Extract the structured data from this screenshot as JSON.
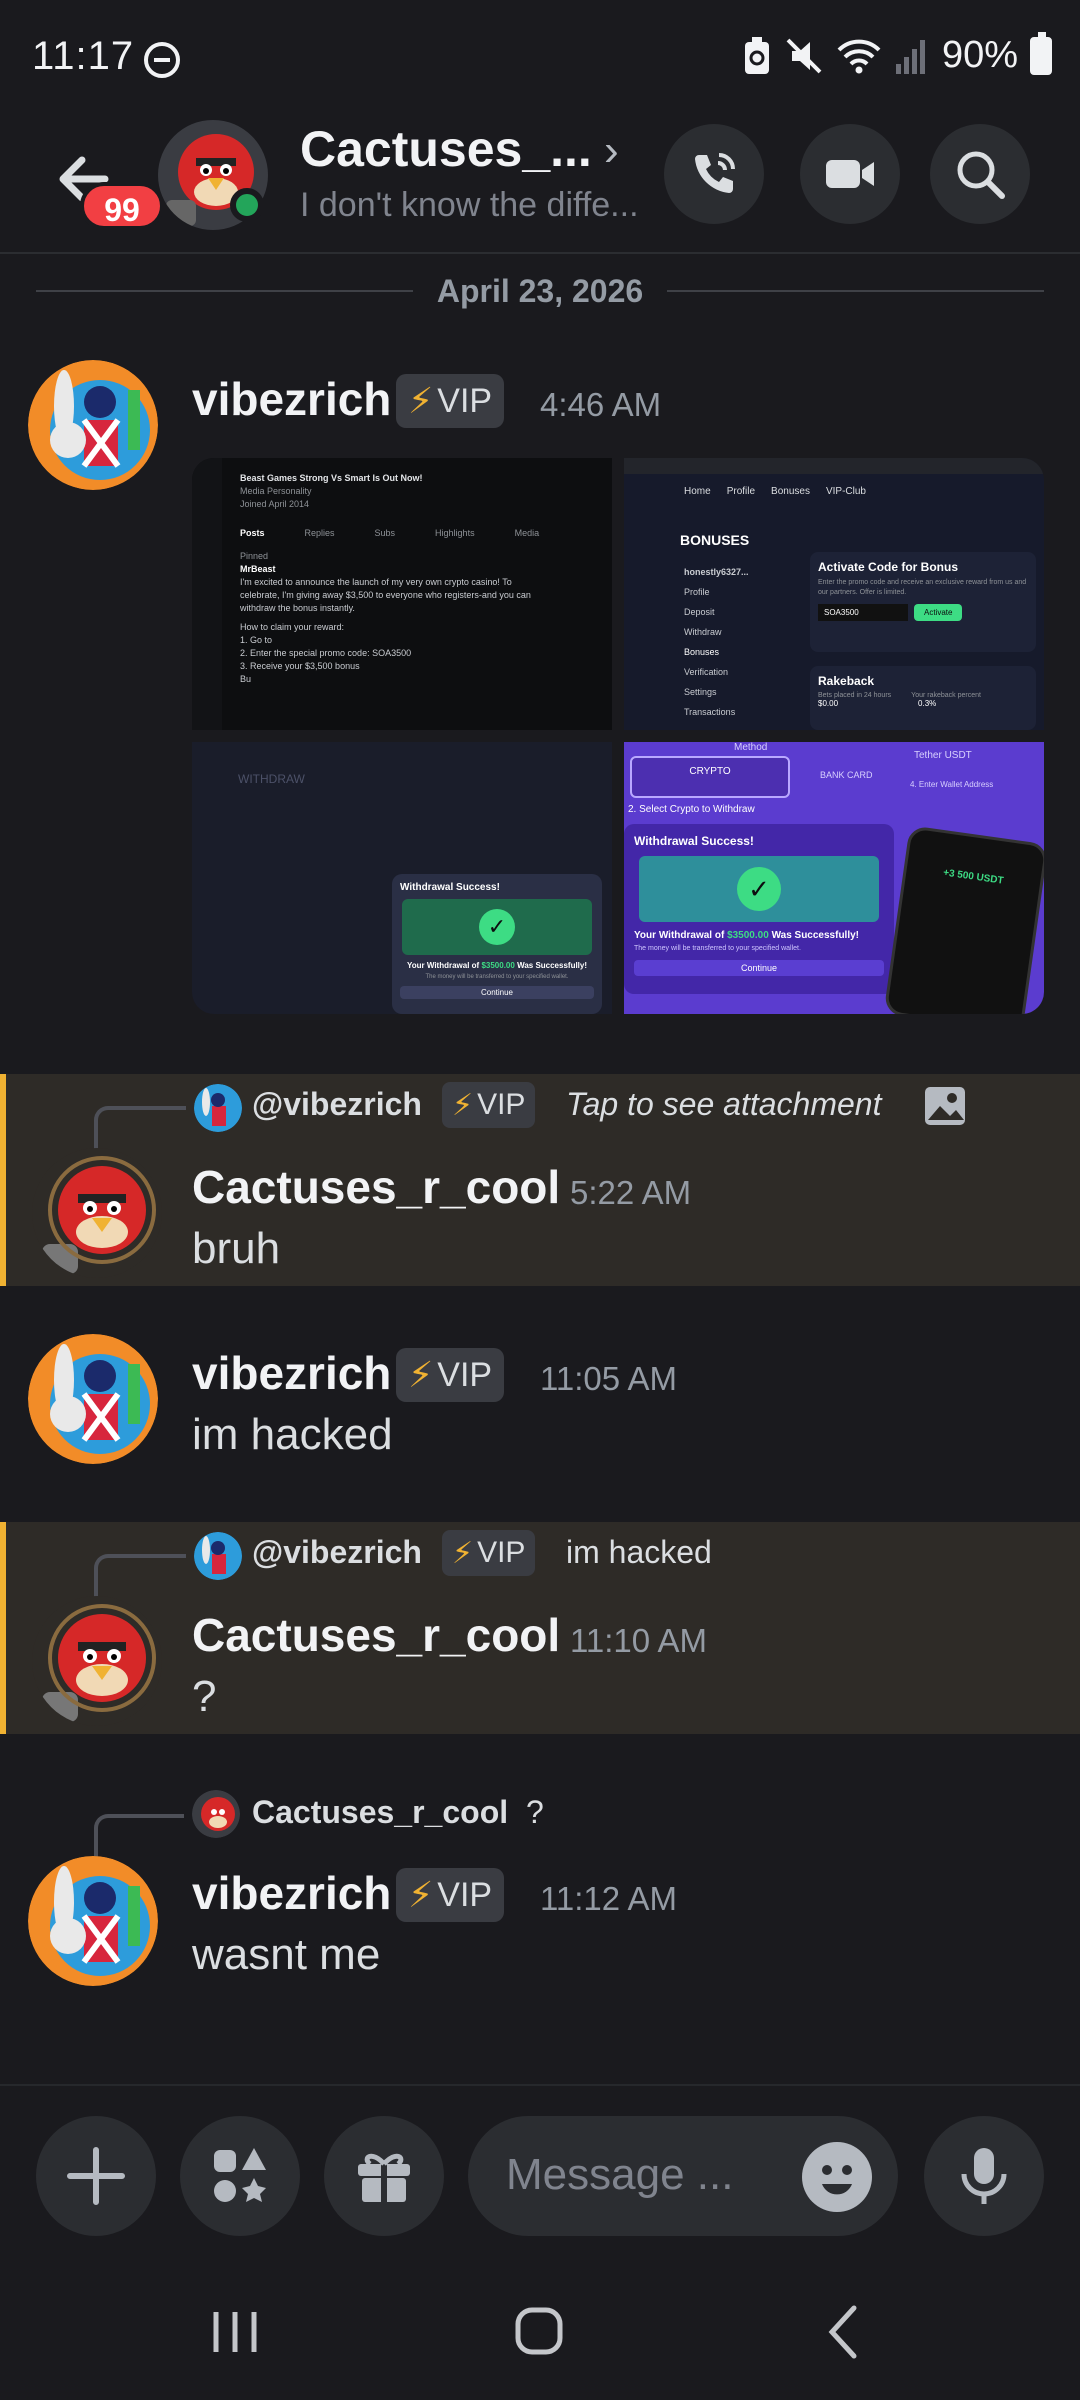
{
  "status_bar": {
    "time": "11:17",
    "battery": "90%"
  },
  "header": {
    "title": "Cactuses_...",
    "subtitle": "I don't know the diffe...",
    "unread_badge": "99"
  },
  "date_divider": "April 23, 2026",
  "messages": [
    {
      "author": "vibezrich",
      "tag": "VIP",
      "time": "4:46 AM",
      "attachments": [
        {
          "title": "MrBeast promo tweet",
          "lines": [
            "Beast Games Strong Vs Smart Is Out Now!",
            "Media Personality",
            "Joined April 2014",
            "Posts",
            "Replies",
            "Subs",
            "Highlights",
            "Media",
            "Pinned",
            "MrBeast",
            "I'm excited to announce the launch of my very own crypto casino! To",
            "celebrate, I'm giving away $3,500 to everyone who registers-and you can",
            "withdraw the bonus instantly.",
            "How to claim your reward:",
            "1. Go to",
            "2. Enter the special promo code: SOA3500",
            "3. Receive your $3,500 bonus",
            "Bu"
          ]
        },
        {
          "title": "Bonuses page",
          "lines": [
            "Home",
            "Profile",
            "Bonuses",
            "VIP-Club",
            "BONUSES",
            "honestly6327...",
            "Profile",
            "Deposit",
            "Withdraw",
            "Bonuses",
            "Verification",
            "Settings",
            "Transactions",
            "Activate Code for Bonus",
            "Enter the promo code and receive an exclusive reward from us and our partners. Offer is limited.",
            "SOA3500",
            "Activate",
            "Rakeback",
            "Bets placed in 24 hours",
            "Your rakeback percent",
            "$0.00",
            "0.3%"
          ]
        },
        {
          "title": "Withdraw page",
          "lines": [
            "WITHDRAW",
            "Withdrawal Success!",
            "Your Withdrawal of",
            "$3500.00",
            "Was Successfully!",
            "The money will be transferred to your specified wallet.",
            "Continue"
          ]
        },
        {
          "title": "Withdrawal success",
          "lines": [
            "Method",
            "CRYPTO",
            "BANK CARD",
            "Tether USDT",
            "2. Select Crypto to Withdraw",
            "4. Enter Wallet Address",
            "Withdrawal Success!",
            "Your Withdrawal of",
            "$3500.00",
            "Was Successfully!",
            "The money will be transferred to your specified wallet.",
            "Continue",
            "+3 500 USDT"
          ]
        }
      ]
    },
    {
      "author": "Cactuses_r_cool",
      "time": "5:22 AM",
      "text": "bruh",
      "reply": {
        "author": "@vibezrich",
        "tag": "VIP",
        "text": "Tap to see attachment"
      }
    },
    {
      "author": "vibezrich",
      "tag": "VIP",
      "time": "11:05 AM",
      "text": "im hacked"
    },
    {
      "author": "Cactuses_r_cool",
      "time": "11:10 AM",
      "text": "?",
      "reply": {
        "author": "@vibezrich",
        "tag": "VIP",
        "text": "im hacked"
      }
    },
    {
      "author": "vibezrich",
      "tag": "VIP",
      "time": "11:12 AM",
      "text": "wasnt me",
      "reply": {
        "author": "Cactuses_r_cool",
        "text": "?"
      }
    }
  ],
  "composer": {
    "placeholder": "Message ..."
  },
  "colors": {
    "accent": "#f0b232",
    "online": "#23a55a",
    "badge": "#f23f43",
    "background": "#1a1a1e"
  },
  "icons": [
    "back-arrow-icon",
    "chevron-right-icon",
    "phone-call-icon",
    "video-camera-icon",
    "search-icon",
    "plus-icon",
    "apps-icon",
    "gift-icon",
    "emoji-icon",
    "microphone-icon",
    "image-icon",
    "bolt-icon"
  ]
}
